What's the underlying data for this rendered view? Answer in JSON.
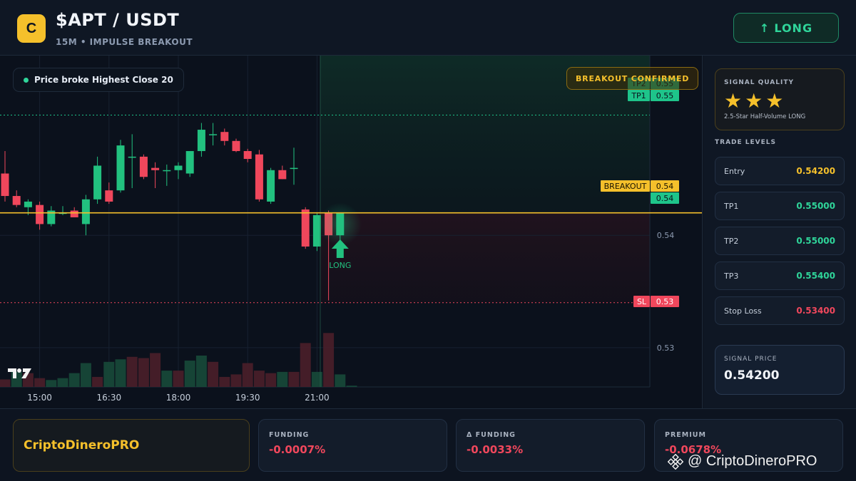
{
  "header": {
    "logo_letter": "C",
    "pair": "$APT / USDT",
    "subtitle": "15M • IMPULSE BREAKOUT",
    "signal_button": {
      "icon": "arrow-up-icon",
      "arrow": "↑",
      "label": "LONG"
    }
  },
  "chart": {
    "status_pill": "Price broke Highest Close 20",
    "confirm_badge": "BREAKOUT CONFIRMED",
    "long_marker": "LONG",
    "price_tags": {
      "tp2": {
        "label": "TP2",
        "value": "0.55"
      },
      "tp1": {
        "label": "TP1",
        "value": "0.55"
      },
      "breakout": {
        "label": "BREAKOUT",
        "value": "0.54"
      },
      "current": "0.54",
      "sl": {
        "label": "SL",
        "value": "0.53"
      }
    },
    "axis_labels": [
      "0.54",
      "0.53"
    ],
    "time_labels": [
      "15:00",
      "16:30",
      "18:00",
      "19:30",
      "21:00"
    ],
    "colors": {
      "up": "#22c17f",
      "down": "#f0475c",
      "breakout": "#f5c02b",
      "tp": "#1ec48a"
    }
  },
  "chart_data": {
    "type": "candlestick",
    "y_range": [
      0.5265,
      0.556
    ],
    "levels": {
      "tp": 0.5507,
      "breakout": 0.542,
      "sl": 0.534
    },
    "candles": [
      {
        "o": 0.5455,
        "h": 0.5475,
        "l": 0.543,
        "c": 0.5435
      },
      {
        "o": 0.5435,
        "h": 0.544,
        "l": 0.5425,
        "c": 0.5427
      },
      {
        "o": 0.5425,
        "h": 0.5432,
        "l": 0.5418,
        "c": 0.543
      },
      {
        "o": 0.5427,
        "h": 0.543,
        "l": 0.5405,
        "c": 0.541
      },
      {
        "o": 0.541,
        "h": 0.5426,
        "l": 0.5408,
        "c": 0.5422
      },
      {
        "o": 0.542,
        "h": 0.5426,
        "l": 0.5418,
        "c": 0.542
      },
      {
        "o": 0.5422,
        "h": 0.5425,
        "l": 0.5416,
        "c": 0.5416
      },
      {
        "o": 0.541,
        "h": 0.5436,
        "l": 0.54,
        "c": 0.5432
      },
      {
        "o": 0.5432,
        "h": 0.547,
        "l": 0.5428,
        "c": 0.5462
      },
      {
        "o": 0.544,
        "h": 0.5447,
        "l": 0.5428,
        "c": 0.543
      },
      {
        "o": 0.544,
        "h": 0.5485,
        "l": 0.5438,
        "c": 0.548
      },
      {
        "o": 0.547,
        "h": 0.549,
        "l": 0.5442,
        "c": 0.547
      },
      {
        "o": 0.547,
        "h": 0.5472,
        "l": 0.545,
        "c": 0.5452
      },
      {
        "o": 0.546,
        "h": 0.5465,
        "l": 0.5442,
        "c": 0.5458
      },
      {
        "o": 0.5458,
        "h": 0.5463,
        "l": 0.5444,
        "c": 0.5458
      },
      {
        "o": 0.5458,
        "h": 0.5465,
        "l": 0.545,
        "c": 0.5462
      },
      {
        "o": 0.5455,
        "h": 0.5475,
        "l": 0.5452,
        "c": 0.5475
      },
      {
        "o": 0.5475,
        "h": 0.55,
        "l": 0.547,
        "c": 0.5494
      },
      {
        "o": 0.549,
        "h": 0.55,
        "l": 0.548,
        "c": 0.549
      },
      {
        "o": 0.5492,
        "h": 0.5495,
        "l": 0.548,
        "c": 0.5484
      },
      {
        "o": 0.5484,
        "h": 0.5486,
        "l": 0.5474,
        "c": 0.5475
      },
      {
        "o": 0.5475,
        "h": 0.5477,
        "l": 0.5465,
        "c": 0.5468
      },
      {
        "o": 0.5472,
        "h": 0.5476,
        "l": 0.543,
        "c": 0.5432
      },
      {
        "o": 0.543,
        "h": 0.546,
        "l": 0.5428,
        "c": 0.5458
      },
      {
        "o": 0.5458,
        "h": 0.5462,
        "l": 0.545,
        "c": 0.545
      },
      {
        "o": 0.546,
        "h": 0.5478,
        "l": 0.5445,
        "c": 0.546
      },
      {
        "o": 0.5423,
        "h": 0.5425,
        "l": 0.5388,
        "c": 0.539
      },
      {
        "o": 0.539,
        "h": 0.542,
        "l": 0.5386,
        "c": 0.5418
      },
      {
        "o": 0.542,
        "h": 0.5422,
        "l": 0.5342,
        "c": 0.54
      },
      {
        "o": 0.54,
        "h": 0.542,
        "l": 0.5392,
        "c": 0.542
      }
    ],
    "volume": [
      0.12,
      0.24,
      0.22,
      0.14,
      0.11,
      0.14,
      0.22,
      0.38,
      0.16,
      0.4,
      0.44,
      0.48,
      0.46,
      0.54,
      0.26,
      0.26,
      0.42,
      0.5,
      0.4,
      0.16,
      0.2,
      0.38,
      0.26,
      0.22,
      0.24,
      0.24,
      0.7,
      0.24,
      0.86,
      0.2,
      0.02
    ],
    "volume_up": [
      false,
      true,
      false,
      false,
      true,
      true,
      true,
      true,
      false,
      true,
      true,
      false,
      false,
      false,
      true,
      false,
      true,
      true,
      false,
      false,
      false,
      false,
      false,
      false,
      true,
      false,
      false,
      true,
      false,
      true,
      true
    ],
    "x_labels": [
      "15:00",
      "16:30",
      "18:00",
      "19:30",
      "21:00"
    ]
  },
  "sidebar": {
    "quality_title": "SIGNAL QUALITY",
    "stars": [
      "★",
      "★",
      "★"
    ],
    "star_icon": "star-icon",
    "quality_desc": "2.5-Star Half-Volume LONG",
    "levels_title": "TRADE LEVELS",
    "levels": [
      {
        "key": "Entry",
        "value": "0.54200",
        "color": "#f5c02b"
      },
      {
        "key": "TP1",
        "value": "0.55000",
        "color": "#2fd59a"
      },
      {
        "key": "TP2",
        "value": "0.55000",
        "color": "#2fd59a"
      },
      {
        "key": "TP3",
        "value": "0.55400",
        "color": "#2fd59a"
      },
      {
        "key": "Stop Loss",
        "value": "0.53400",
        "color": "#f0475c"
      }
    ],
    "signal_price_title": "SIGNAL PRICE",
    "signal_price": "0.54200"
  },
  "footer": {
    "brand": "CriptoDineroPRO",
    "stats": [
      {
        "key": "FUNDING",
        "value": "-0.0007%"
      },
      {
        "key": "Δ FUNDING",
        "value": "-0.0033%"
      },
      {
        "key": "PREMIUM",
        "value": "-0.0678%"
      }
    ],
    "watermark": "@ CriptoDineroPRO"
  }
}
